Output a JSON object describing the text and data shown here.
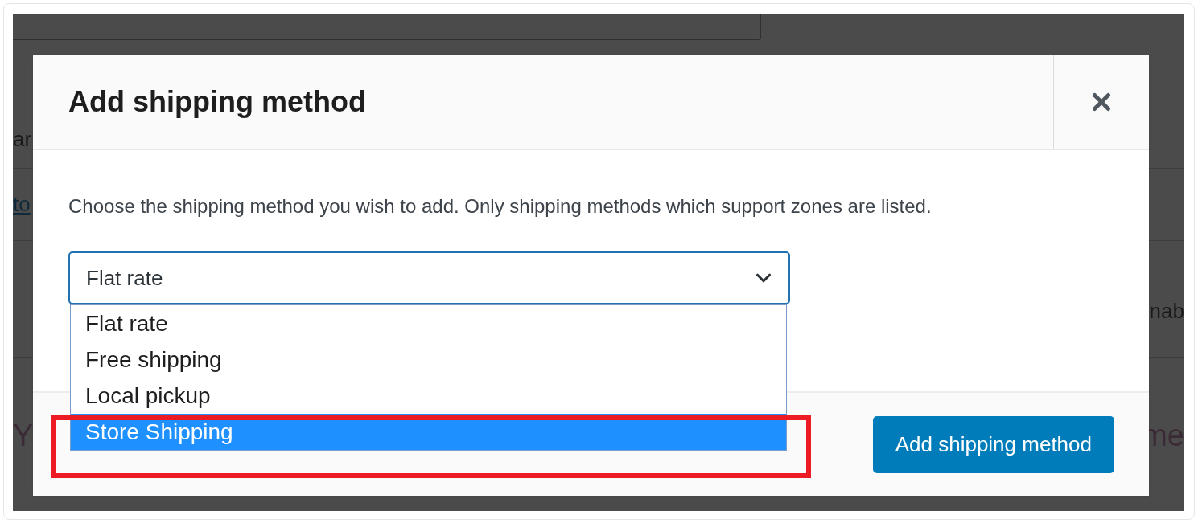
{
  "background_rows": [
    {
      "left": [
        {
          "text": "ar",
          "kind": "text"
        }
      ]
    },
    {
      "left": [
        {
          "text": "to",
          "kind": "link"
        }
      ]
    },
    {
      "right": [
        {
          "text": "nab",
          "kind": "text"
        }
      ]
    },
    {
      "left": [
        {
          "text": "Y",
          "kind": "heading"
        }
      ],
      "right": [
        {
          "text": "me",
          "kind": "heading"
        }
      ]
    }
  ],
  "dialog": {
    "title": "Add shipping method",
    "description": "Choose the shipping method you wish to add. Only shipping methods which support zones are listed.",
    "select": {
      "value": "Flat rate",
      "expanded": true,
      "options": [
        {
          "label": "Flat rate",
          "highlighted": false
        },
        {
          "label": "Free shipping",
          "highlighted": false
        },
        {
          "label": "Local pickup",
          "highlighted": false
        },
        {
          "label": "Store Shipping",
          "highlighted": true
        }
      ]
    },
    "submit_button": "Add shipping method"
  },
  "annotation": {
    "kind": "highlight-box",
    "color": "#ed1c24"
  }
}
